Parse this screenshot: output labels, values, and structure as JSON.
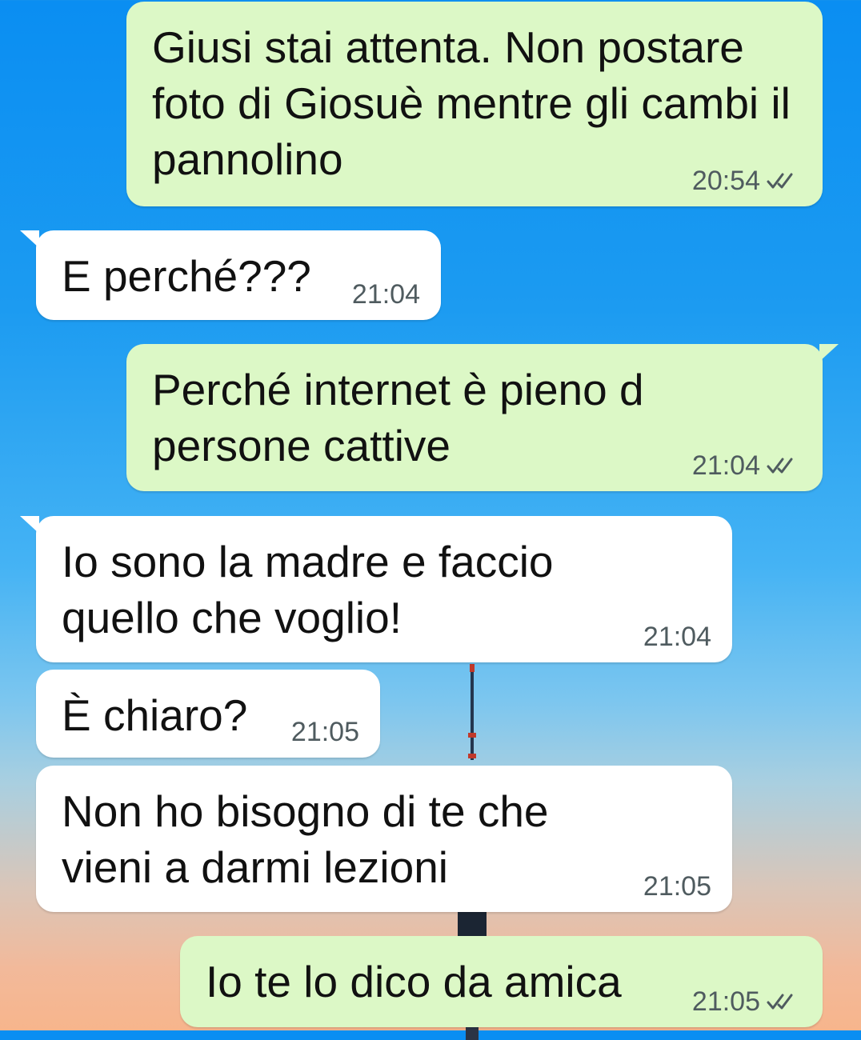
{
  "messages": [
    {
      "direction": "outgoing",
      "text": "Giusi stai attenta. Non postare foto di Giosuè mentre gli cambi il pannolino",
      "time": "20:54",
      "status_icon": "double-check-icon"
    },
    {
      "direction": "incoming",
      "text": "E perché???",
      "time": "21:04"
    },
    {
      "direction": "outgoing",
      "text": "Perché internet è pieno d persone cattive",
      "time": "21:04",
      "status_icon": "double-check-icon"
    },
    {
      "direction": "incoming",
      "text": "Io sono la madre e faccio quello che voglio!",
      "time": "21:04"
    },
    {
      "direction": "incoming",
      "text": "È chiaro?",
      "time": "21:05"
    },
    {
      "direction": "incoming",
      "text": "Non ho bisogno di te che vieni a darmi lezioni",
      "time": "21:05"
    },
    {
      "direction": "outgoing",
      "text": "Io te lo dico da amica",
      "time": "21:05",
      "status_icon": "double-check-icon"
    }
  ],
  "colors": {
    "outgoing_bubble": "#dcf8c6",
    "incoming_bubble": "#ffffff",
    "meta_text": "#4f5b5f"
  }
}
